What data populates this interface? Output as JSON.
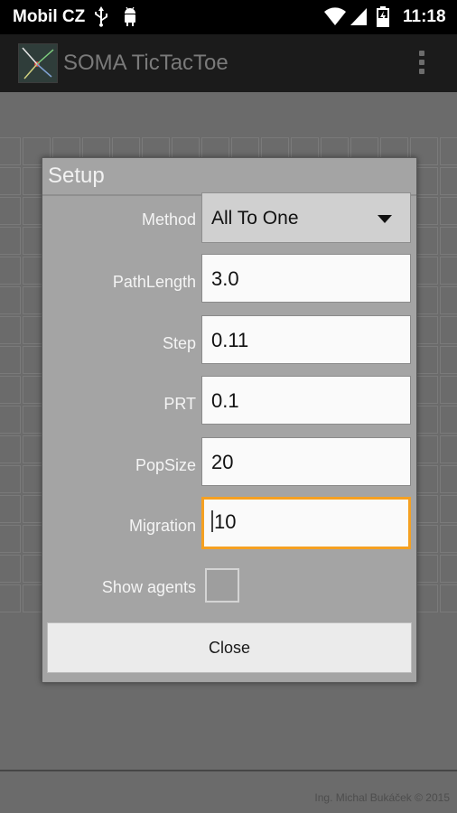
{
  "status": {
    "carrier": "Mobil CZ",
    "time": "11:18",
    "icons": [
      "usb-icon",
      "android-debug-icon",
      "wifi-icon",
      "signal-icon",
      "battery-icon"
    ]
  },
  "app": {
    "title": "SOMA TicTacToe",
    "menu_icon": "overflow-menu-icon"
  },
  "footer": {
    "credit": "Ing. Michal Bukáček © 2015"
  },
  "dialog": {
    "title": "Setup",
    "method": {
      "label": "Method",
      "value": "All To One"
    },
    "fields": [
      {
        "label": "PathLength",
        "value": "3.0"
      },
      {
        "label": "Step",
        "value": "0.11"
      },
      {
        "label": "PRT",
        "value": "0.1"
      },
      {
        "label": "PopSize",
        "value": "20"
      },
      {
        "label": "Migration",
        "value": "10"
      }
    ],
    "show_agents": {
      "label": "Show agents",
      "checked": false
    },
    "close_label": "Close"
  },
  "colors": {
    "focus": "#f5a021",
    "dialog_bg": "#a4a4a4",
    "background": "#6b6b6b"
  }
}
